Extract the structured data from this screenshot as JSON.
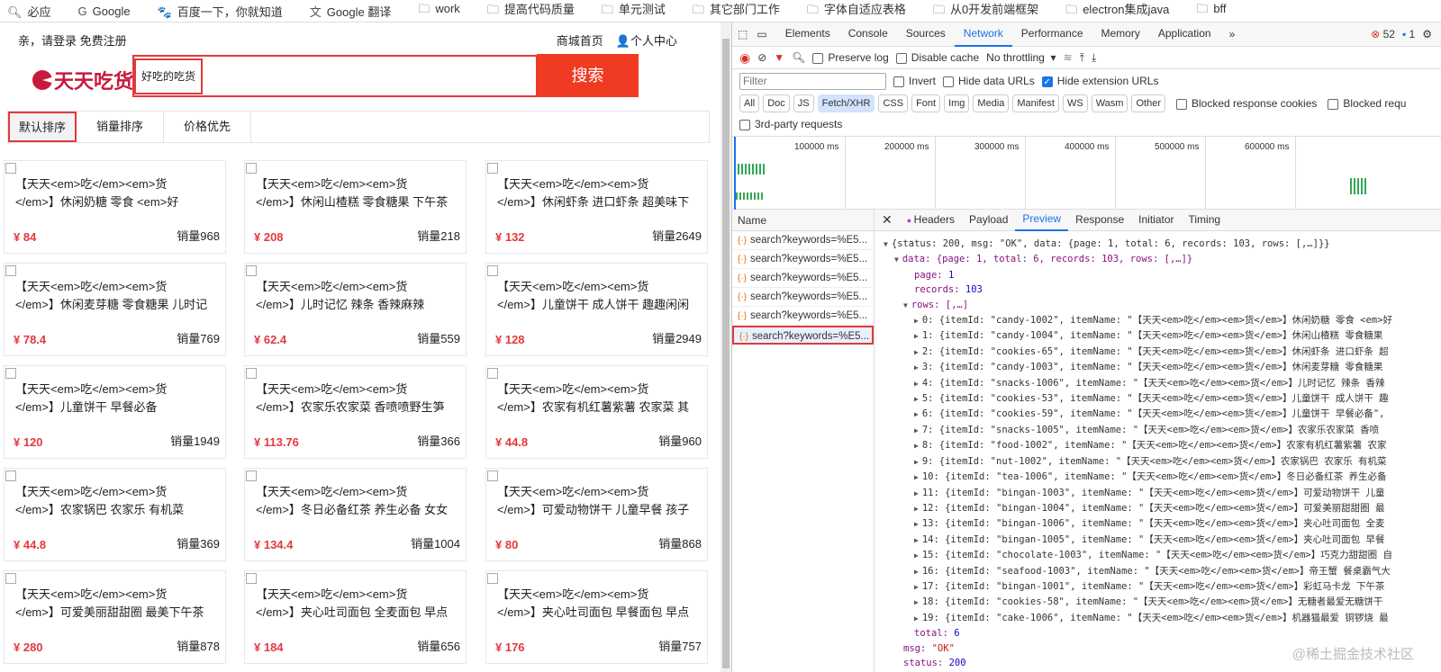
{
  "bookmarks": [
    {
      "icon": "search-icon",
      "label": "必应"
    },
    {
      "icon": "google-icon",
      "label": "Google"
    },
    {
      "icon": "baidu-icon",
      "label": "百度一下，你就知道"
    },
    {
      "icon": "translate-icon",
      "label": "Google 翻译"
    },
    {
      "icon": "folder-icon",
      "label": "work"
    },
    {
      "icon": "folder-icon",
      "label": "提高代码质量"
    },
    {
      "icon": "folder-icon",
      "label": "单元测试"
    },
    {
      "icon": "folder-icon",
      "label": "其它部门工作"
    },
    {
      "icon": "folder-icon",
      "label": "字体自适应表格"
    },
    {
      "icon": "folder-icon",
      "label": "从0开发前端框架"
    },
    {
      "icon": "folder-icon",
      "label": "electron集成java"
    },
    {
      "icon": "folder-icon",
      "label": "bff"
    }
  ],
  "site": {
    "login_text": "亲，请登录 免费注册",
    "home_link": "商城首页",
    "user_center": "个人中心",
    "logo": "天天吃货",
    "search_value": "好吃的吃货",
    "search_button": "搜索",
    "accent": "#e4393c",
    "sort_tabs": [
      "默认排序",
      "销量排序",
      "价格优先"
    ],
    "products": [
      {
        "line1": "【天天<em>吃</em><em>货",
        "line2": "</em>】休闲奶糖 零食 <em>好",
        "price": "¥ 84",
        "sales": "销量968"
      },
      {
        "line1": "【天天<em>吃</em><em>货",
        "line2": "</em>】休闲山楂糕 零食糖果 下午茶",
        "price": "¥ 208",
        "sales": "销量218"
      },
      {
        "line1": "【天天<em>吃</em><em>货",
        "line2": "</em>】休闲虾条 进口虾条 超美味下",
        "price": "¥ 132",
        "sales": "销量2649"
      },
      {
        "line1": "【天天<em>吃</em><em>货",
        "line2": "</em>】休闲麦芽糖 零食糖果 儿时记",
        "price": "¥ 78.4",
        "sales": "销量769"
      },
      {
        "line1": "【天天<em>吃</em><em>货",
        "line2": "</em>】儿时记忆 辣条 香辣麻辣",
        "price": "¥ 62.4",
        "sales": "销量559"
      },
      {
        "line1": "【天天<em>吃</em><em>货",
        "line2": "</em>】儿童饼干 成人饼干 趣趣闲闲",
        "price": "¥ 128",
        "sales": "销量2949"
      },
      {
        "line1": "【天天<em>吃</em><em>货",
        "line2": "</em>】儿童饼干 早餐必备",
        "price": "¥ 120",
        "sales": "销量1949"
      },
      {
        "line1": "【天天<em>吃</em><em>货",
        "line2": "</em>】农家乐农家菜 香喷喷野生笋",
        "price": "¥ 113.76",
        "sales": "销量366"
      },
      {
        "line1": "【天天<em>吃</em><em>货",
        "line2": "</em>】农家有机红薯紫薯 农家菜 其",
        "price": "¥ 44.8",
        "sales": "销量960"
      },
      {
        "line1": "【天天<em>吃</em><em>货",
        "line2": "</em>】农家锅巴 农家乐 有机菜",
        "price": "¥ 44.8",
        "sales": "销量369"
      },
      {
        "line1": "【天天<em>吃</em><em>货",
        "line2": "</em>】冬日必备红茶 养生必备 女女",
        "price": "¥ 134.4",
        "sales": "销量1004"
      },
      {
        "line1": "【天天<em>吃</em><em>货",
        "line2": "</em>】可爱动物饼干 儿童早餐 孩子",
        "price": "¥ 80",
        "sales": "销量868"
      },
      {
        "line1": "【天天<em>吃</em><em>货",
        "line2": "</em>】可爱美丽甜甜圈 最美下午茶",
        "price": "¥ 280",
        "sales": "销量878"
      },
      {
        "line1": "【天天<em>吃</em><em>货",
        "line2": "</em>】夹心吐司面包 全麦面包 早点",
        "price": "¥ 184",
        "sales": "销量656"
      },
      {
        "line1": "【天天<em>吃</em><em>货",
        "line2": "</em>】夹心吐司面包 早餐面包 早点",
        "price": "¥ 176",
        "sales": "销量757"
      }
    ]
  },
  "devtools": {
    "tabs": [
      "Elements",
      "Console",
      "Sources",
      "Network",
      "Performance",
      "Memory",
      "Application"
    ],
    "active_tab": "Network",
    "more": "»",
    "errors": "52",
    "messages": "1",
    "toolbar": {
      "preserve_log": "Preserve log",
      "disable_cache": "Disable cache",
      "throttling": "No throttling"
    },
    "filter": {
      "placeholder": "Filter",
      "invert": "Invert",
      "hide_data": "Hide data URLs",
      "hide_ext": "Hide extension URLs"
    },
    "types": [
      "All",
      "Doc",
      "JS",
      "Fetch/XHR",
      "CSS",
      "Font",
      "Img",
      "Media",
      "Manifest",
      "WS",
      "Wasm",
      "Other"
    ],
    "active_type": "Fetch/XHR",
    "blocked_cookies": "Blocked response cookies",
    "blocked_req": "Blocked requ",
    "third_party": "3rd-party requests",
    "timeline_ticks": [
      "100000 ms",
      "200000 ms",
      "300000 ms",
      "400000 ms",
      "500000 ms",
      "600000 ms"
    ],
    "name_header": "Name",
    "requests": [
      "search?keywords=%E5...",
      "search?keywords=%E5...",
      "search?keywords=%E5...",
      "search?keywords=%E5...",
      "search?keywords=%E5...",
      "search?keywords=%E5..."
    ],
    "detail_tabs": [
      "Headers",
      "Payload",
      "Preview",
      "Response",
      "Initiator",
      "Timing"
    ],
    "active_detail": "Preview",
    "preview": {
      "root": "{status: 200, msg: \"OK\", data: {page: 1, total: 6, records: 103, rows: [,…]}}",
      "data": "data: {page: 1, total: 6, records: 103, rows: [,…]}",
      "page": "1",
      "records": "103",
      "rows_label": "rows: [,…]",
      "rows": [
        "0: {itemId: \"candy-1002\", itemName: \"【天天<em>吃</em><em>货</em>】休闲奶糖 零食 <em>好",
        "1: {itemId: \"candy-1004\", itemName: \"【天天<em>吃</em><em>货</em>】休闲山楂糕 零食糖果",
        "2: {itemId: \"cookies-65\", itemName: \"【天天<em>吃</em><em>货</em>】休闲虾条 进口虾条 超",
        "3: {itemId: \"candy-1003\", itemName: \"【天天<em>吃</em><em>货</em>】休闲麦芽糖 零食糖果",
        "4: {itemId: \"snacks-1006\", itemName: \"【天天<em>吃</em><em>货</em>】儿时记忆 辣条 香辣",
        "5: {itemId: \"cookies-53\", itemName: \"【天天<em>吃</em><em>货</em>】儿童饼干 成人饼干 趣",
        "6: {itemId: \"cookies-59\", itemName: \"【天天<em>吃</em><em>货</em>】儿童饼干 早餐必备\",",
        "7: {itemId: \"snacks-1005\", itemName: \"【天天<em>吃</em><em>货</em>】农家乐农家菜 香喷",
        "8: {itemId: \"food-1002\", itemName: \"【天天<em>吃</em><em>货</em>】农家有机红薯紫薯 农家",
        "9: {itemId: \"nut-1002\", itemName: \"【天天<em>吃</em><em>货</em>】农家锅巴 农家乐 有机菜",
        "10: {itemId: \"tea-1006\", itemName: \"【天天<em>吃</em><em>货</em>】冬日必备红茶 养生必备",
        "11: {itemId: \"bingan-1003\", itemName: \"【天天<em>吃</em><em>货</em>】可爱动物饼干 儿童",
        "12: {itemId: \"bingan-1004\", itemName: \"【天天<em>吃</em><em>货</em>】可爱美丽甜甜圈 最",
        "13: {itemId: \"bingan-1006\", itemName: \"【天天<em>吃</em><em>货</em>】夹心吐司面包 全麦",
        "14: {itemId: \"bingan-1005\", itemName: \"【天天<em>吃</em><em>货</em>】夹心吐司面包 早餐",
        "15: {itemId: \"chocolate-1003\", itemName: \"【天天<em>吃</em><em>货</em>】巧克力甜甜圈 自",
        "16: {itemId: \"seafood-1003\", itemName: \"【天天<em>吃</em><em>货</em>】帝王蟹 餐桌霸气大",
        "17: {itemId: \"bingan-1001\", itemName: \"【天天<em>吃</em><em>货</em>】彩虹马卡龙 下午茶",
        "18: {itemId: \"cookies-58\", itemName: \"【天天<em>吃</em><em>货</em>】无糖者最爱无糖饼干",
        "19: {itemId: \"cake-1006\", itemName: \"【天天<em>吃</em><em>货</em>】机器猫最爱 铜锣烧 最"
      ],
      "total": "6",
      "msg": "\"OK\"",
      "status": "200"
    }
  },
  "watermark": "@稀土掘金技术社区"
}
